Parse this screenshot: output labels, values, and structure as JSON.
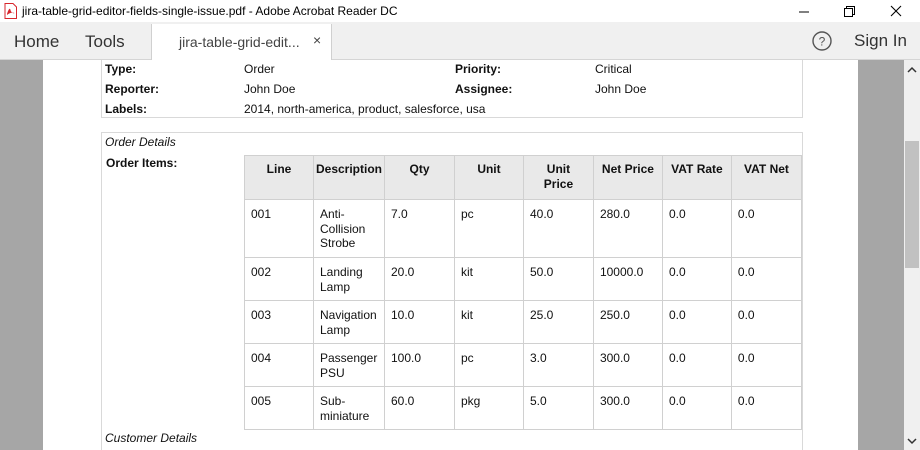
{
  "window": {
    "title": "jira-table-grid-editor-fields-single-issue.pdf - Adobe Acrobat Reader DC"
  },
  "toolbar": {
    "home_label": "Home",
    "tools_label": "Tools",
    "tab_label": "jira-table-grid-edit...",
    "tab_close": "×",
    "signin_label": "Sign In"
  },
  "issue": {
    "fields": [
      {
        "label": "Type:",
        "value": "Order"
      },
      {
        "label": "Priority:",
        "value": "Critical"
      },
      {
        "label": "Reporter:",
        "value": "John Doe"
      },
      {
        "label": "Assignee:",
        "value": "John Doe"
      },
      {
        "label": "Labels:",
        "value": "2014, north-america, product, salesforce, usa"
      }
    ]
  },
  "order": {
    "section_title": "Order Details",
    "items_label": "Order Items:",
    "columns": [
      "Line",
      "Description",
      "Qty",
      "Unit",
      "Unit Price",
      "Net Price",
      "VAT Rate",
      "VAT Net"
    ],
    "rows": [
      [
        "001",
        "Anti-Collision Strobe",
        "7.0",
        "pc",
        "40.0",
        "280.0",
        "0.0",
        "0.0"
      ],
      [
        "002",
        "Landing Lamp",
        "20.0",
        "kit",
        "50.0",
        "10000.0",
        "0.0",
        "0.0"
      ],
      [
        "003",
        "Navigation Lamp",
        "10.0",
        "kit",
        "25.0",
        "250.0",
        "0.0",
        "0.0"
      ],
      [
        "004",
        "Passenger PSU",
        "100.0",
        "pc",
        "3.0",
        "300.0",
        "0.0",
        "0.0"
      ],
      [
        "005",
        "Sub-miniature",
        "60.0",
        "pkg",
        "5.0",
        "300.0",
        "0.0",
        "0.0"
      ]
    ]
  },
  "customer": {
    "section_title": "Customer Details"
  },
  "colors": {
    "viewer_bg": "#a6a6a6",
    "menubar_bg": "#f0f0f0",
    "table_header_bg": "#e9e9e9",
    "pdf_icon": "#d7262c"
  },
  "icons": {
    "app": "pdf-file-icon",
    "minimize": "minimize-icon",
    "restore": "restore-icon",
    "close": "close-icon",
    "help": "help-icon",
    "scroll_up": "scroll-up-icon",
    "scroll_down": "scroll-down-icon"
  }
}
